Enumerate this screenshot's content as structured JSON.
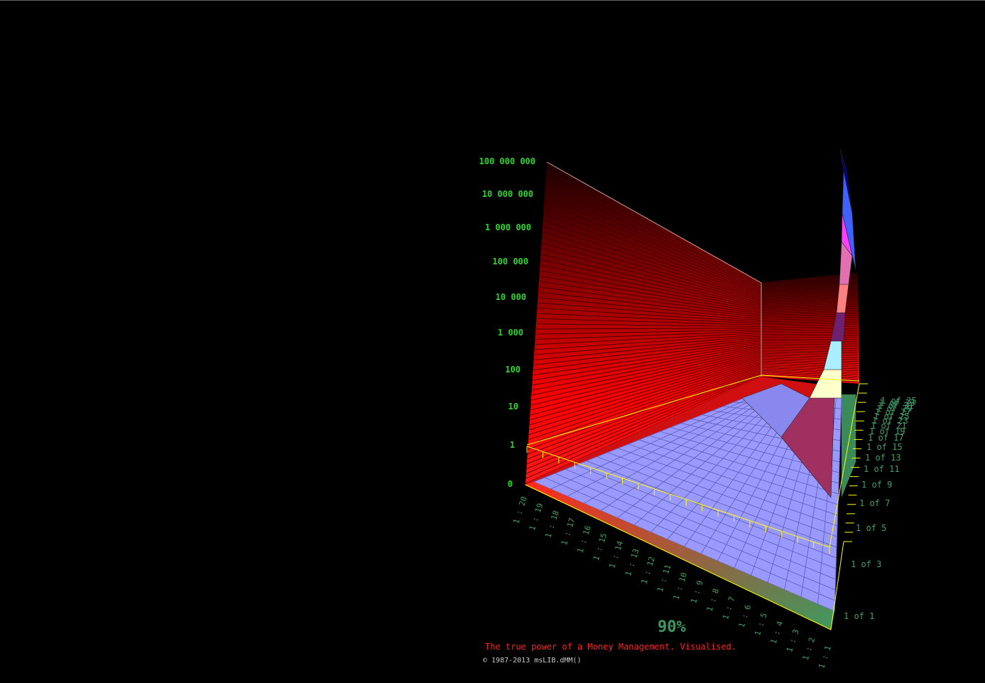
{
  "chart_data": {
    "type": "surface3d",
    "z_scale": "log",
    "z_ticks": [
      "100 000 000",
      "10 000 000",
      "1 000 000",
      "100 000",
      "10 000",
      "1 000",
      "100",
      "10",
      "1",
      "0"
    ],
    "x_ticks": [
      "1 : 20",
      "1 : 19",
      "1 : 18",
      "1 : 17",
      "1 : 16",
      "1 : 15",
      "1 : 14",
      "1 : 13",
      "1 : 12",
      "1 : 11",
      "1 : 10",
      "1 : 9",
      "1 : 8",
      "1 : 7",
      "1 : 6",
      "1 : 5",
      "1 : 4",
      "1 : 3",
      "1 : 2",
      "1 : 1"
    ],
    "y_ticks": [
      "1 of 1",
      "1 of 3",
      "1 of 5",
      "1 of 7",
      "1 of 9",
      "1 of 11",
      "1 of 13",
      "1 of 15",
      "1 of 17",
      "1 of 19",
      "1 of 21",
      "1 of 23",
      "1 of 25",
      "1 of 27",
      "1 of 29",
      "1 of 31",
      "1 of 33",
      "1 of 35"
    ],
    "colors": {
      "wall": "#ff0000",
      "surface": "#9999ff",
      "axis": "#ffff00",
      "floor": "#d01818"
    }
  },
  "overlay": {
    "percent": "90%",
    "tagline": "The true power of a Money Management. Visualised.",
    "copyright": "© 1987-2013 msLIB.dMM()"
  }
}
